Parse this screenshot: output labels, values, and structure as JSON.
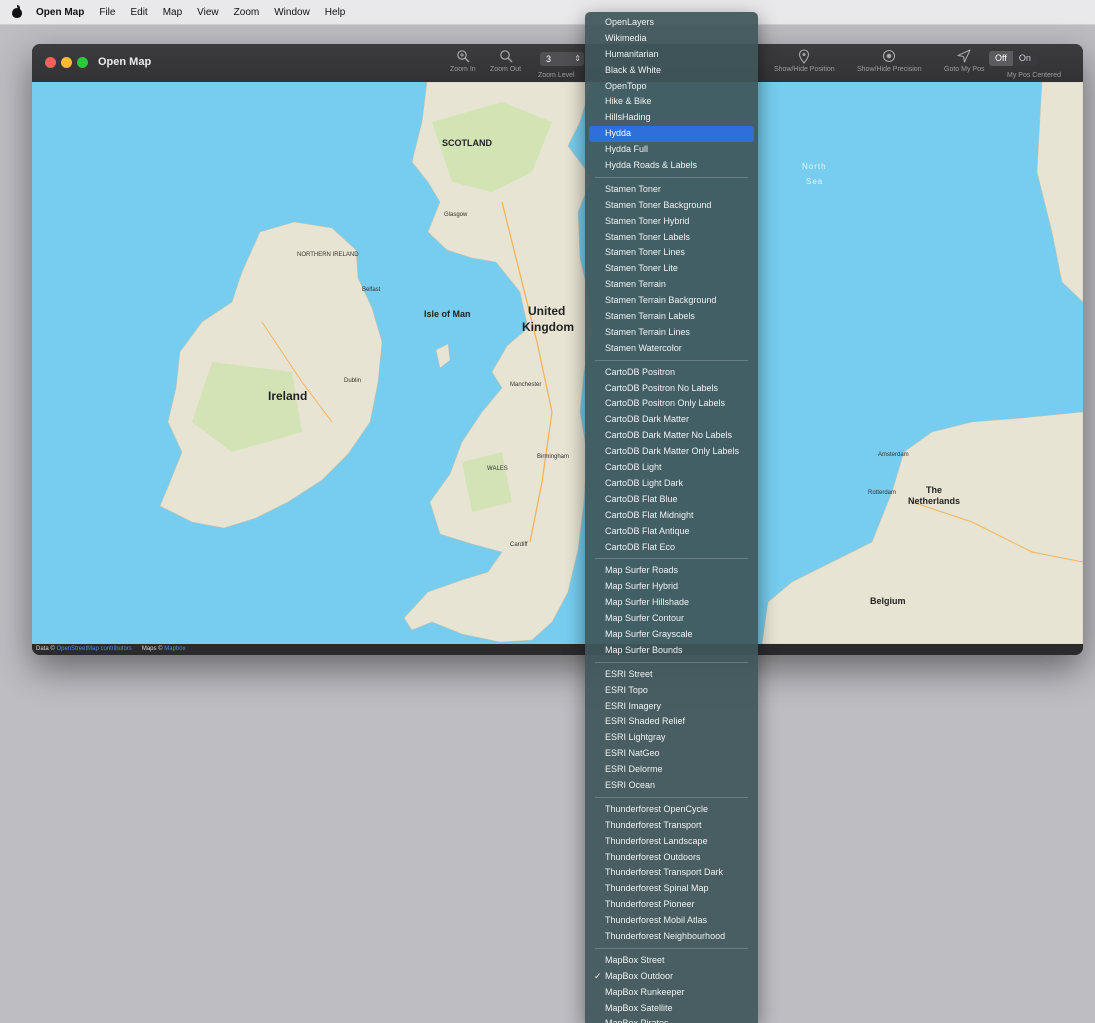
{
  "menubar": {
    "app": "Open Map",
    "items": [
      "File",
      "Edit",
      "Map",
      "View",
      "Zoom",
      "Window",
      "Help"
    ]
  },
  "window": {
    "title": "Open Map",
    "toolbar": {
      "zoom_in": "Zoom In",
      "zoom_out": "Zoom Out",
      "zoom_level_label": "Zoom Level",
      "zoom_level_value": "3",
      "show_hide_position": "Show/Hide Position",
      "show_hide_precision": "Show/Hide Precision",
      "goto_my_pos": "Goto My Pos",
      "my_pos_centered": "My Pos Centered",
      "toggle_off": "Off",
      "toggle_on": "On"
    },
    "status": {
      "data_prefix": "Data ©",
      "data_link": "OpenStreetMap contributors",
      "maps_prefix": "Maps ©",
      "maps_link": "Mapbox"
    }
  },
  "map": {
    "labels": {
      "uk": "United",
      "uk2": "Kingdom",
      "ireland": "Ireland",
      "isle_of_man": "Isle of Man",
      "northern_ireland": "NORTHERN IRELAND",
      "scotland": "SCOTLAND",
      "wales": "WALES",
      "belfast": "Belfast",
      "dublin": "Dublin",
      "glasgow": "Glasgow",
      "manchester": "Manchester",
      "birmingham": "Birmingham",
      "cardiff": "Cardiff",
      "netherlands": "The",
      "netherlands2": "Netherlands",
      "belgium": "Belgium",
      "amsterdam": "Amsterdam",
      "rotterdam": "Rotterdam",
      "north_sea": "North",
      "north_sea2": "Sea"
    }
  },
  "menu": {
    "groups": [
      {
        "items": [
          "OpenLayers",
          "Wikimedia",
          "Humanitarian",
          "Black & White",
          "OpenTopo",
          "Hike & Bike",
          "HillsHading",
          "Hydda",
          "Hydda Full",
          "Hydda Roads & Labels"
        ]
      },
      {
        "items": [
          "Stamen Toner",
          "Stamen Toner Background",
          "Stamen Toner Hybrid",
          "Stamen Toner Labels",
          "Stamen Toner Lines",
          "Stamen Toner Lite",
          "Stamen Terrain",
          "Stamen Terrain Background",
          "Stamen Terrain Labels",
          "Stamen Terrain Lines",
          "Stamen Watercolor"
        ]
      },
      {
        "items": [
          "CartoDB Positron",
          "CartoDB Positron No Labels",
          "CartoDB Positron Only Labels",
          "CartoDB Dark Matter",
          "CartoDB Dark Matter No Labels",
          "CartoDB Dark Matter Only Labels",
          "CartoDB Light",
          "CartoDB Light Dark",
          "CartoDB Flat Blue",
          "CartoDB Flat Midnight",
          "CartoDB Flat Antique",
          "CartoDB Flat Eco"
        ]
      },
      {
        "items": [
          "Map Surfer Roads",
          "Map Surfer Hybrid",
          "Map Surfer Hillshade",
          "Map Surfer Contour",
          "Map Surfer Grayscale",
          "Map Surfer Bounds"
        ]
      },
      {
        "items": [
          "ESRI Street",
          "ESRI Topo",
          "ESRI Imagery",
          "ESRI Shaded Relief",
          "ESRI Lightgray",
          "ESRI NatGeo",
          "ESRI Delorme",
          "ESRI Ocean"
        ]
      },
      {
        "items": [
          "Thunderforest OpenCycle",
          "Thunderforest Transport",
          "Thunderforest Landscape",
          "Thunderforest Outdoors",
          "Thunderforest Transport Dark",
          "Thunderforest Spinal Map",
          "Thunderforest Pioneer",
          "Thunderforest Mobil Atlas",
          "Thunderforest Neighbourhood"
        ]
      },
      {
        "items": [
          "MapBox Street",
          "MapBox Outdoor",
          "MapBox Runkeeper",
          "MapBox Satellite",
          "MapBox Pirates"
        ]
      }
    ],
    "highlighted": "Hydda",
    "checked": "MapBox Outdoor",
    "check_glyph": "✓"
  },
  "colors": {
    "sea": "#76cdef",
    "land": "#e8e4d3",
    "green": "#cfe3b0",
    "highlight": "#2f6fdc",
    "traffic_close": "#fe5f57",
    "traffic_min": "#febc2e",
    "traffic_max": "#28c840"
  },
  "icons": {
    "zoom_in": "zoom-in-magnifier-icon",
    "zoom_out": "zoom-out-magnifier-icon",
    "position": "location-pin-icon",
    "precision": "target-circle-icon",
    "goto": "navigation-arrow-icon"
  }
}
